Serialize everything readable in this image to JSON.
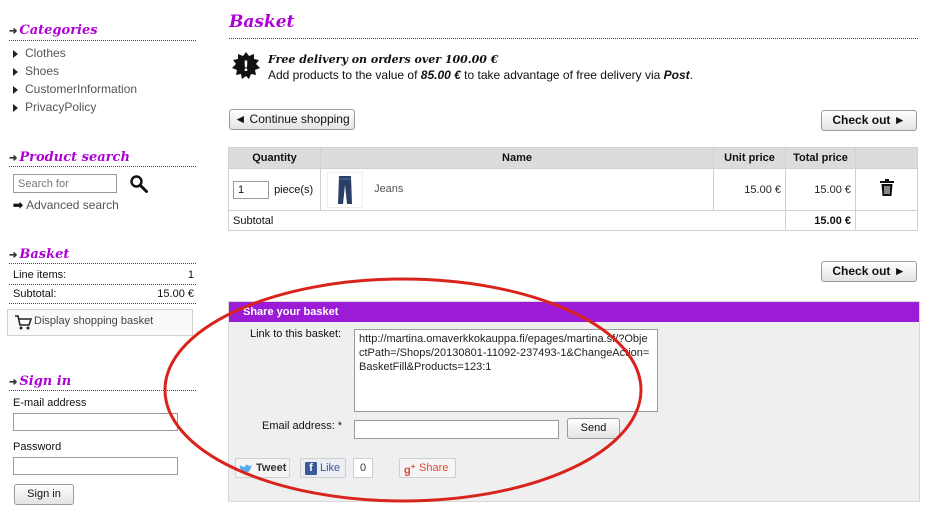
{
  "sidebar": {
    "categories": {
      "heading": "Categories",
      "items": [
        "Clothes",
        "Shoes",
        "CustomerInformation",
        "PrivacyPolicy"
      ]
    },
    "product_search": {
      "heading": "Product search",
      "placeholder": "Search for",
      "advanced_label": "Advanced search"
    },
    "basket": {
      "heading": "Basket",
      "line_items_label": "Line items:",
      "line_items_value": "1",
      "subtotal_label": "Subtotal:",
      "subtotal_value": "15.00 €",
      "display_label": "Display shopping basket"
    },
    "sign_in": {
      "heading": "Sign in",
      "email_label": "E-mail address",
      "password_label": "Password",
      "button_label": "Sign in"
    }
  },
  "main": {
    "title": "Basket",
    "delivery": {
      "headline": "Free delivery on orders over 100.00 €",
      "text_before": "Add products to the value of",
      "amount": "85.00 €",
      "text_middle": "to take advantage of free delivery via",
      "method": "Post",
      "text_end": "."
    },
    "continue_label": "◄ Continue shopping",
    "checkout_label": "Check out ►",
    "table": {
      "headers": [
        "Quantity",
        "Name",
        "Unit price",
        "Total price"
      ],
      "row": {
        "quantity": "1",
        "unit_label": "piece(s)",
        "name": "Jeans",
        "unit_price": "15.00 €",
        "total_price": "15.00 €"
      },
      "subtotal_label": "Subtotal",
      "subtotal_value": "15.00 €"
    },
    "share": {
      "heading": "Share your basket",
      "link_label": "Link to this basket:",
      "link_value": "http://martina.omaverkkokauppa.fi/epages/martina.sf/?ObjectPath=/Shops/20130801-11092-237493-1&ChangeAction=BasketFill&Products=123:1",
      "email_label": "Email address: *",
      "send_label": "Send",
      "tweet_label": "Tweet",
      "like_label": "Like",
      "like_count": "0",
      "share_label": "Share"
    }
  },
  "colors": {
    "accent": "#b000d8",
    "share_bar": "#9b1bd6",
    "annotation": "#d9241d"
  }
}
